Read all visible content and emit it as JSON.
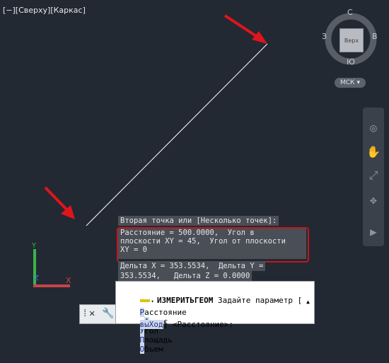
{
  "viewport": {
    "label": "[−][Сверху][Каркас]"
  },
  "viewcube": {
    "north": "С",
    "south": "Ю",
    "east": "В",
    "west": "З",
    "face": "Верх",
    "ucs_label": "МСК",
    "ucs_arrow": "▾"
  },
  "navbar": {
    "icons": [
      "steering-wheel-icon",
      "pan-icon",
      "zoom-icon",
      "orbit-icon",
      "showmotion-icon"
    ]
  },
  "dynamic_input": {
    "prompt": "Вторая точка или [Несколько точек]:",
    "result_lines": [
      "Расстояние = 500.0000,  Угол в",
      "плоскости XY = 45,  Угол от плоскости",
      "XY = 0"
    ],
    "delta_lines": [
      "Дельта X = 353.5534,  Дельта Y =",
      "353.5534,   Дельта Z = 0.0000"
    ]
  },
  "command_line": {
    "command": "ИЗМЕРИТЬГЕОМ",
    "prompt": "Задайте параметр [",
    "options": [
      {
        "pre": "",
        "hot": "Р",
        "post": "асстояние"
      },
      {
        "pre": "р",
        "hot": "А",
        "post": "диус"
      },
      {
        "pre": "",
        "hot": "У",
        "post": "гол"
      },
      {
        "pre": "",
        "hot": "П",
        "post": "лощадь"
      },
      {
        "pre": "",
        "hot": "О",
        "post": "бъем"
      }
    ],
    "exit_option": "выХод",
    "tail": "] <Расстояние>:"
  },
  "mini_toolbar": {
    "close": "✕",
    "customize": "🔧",
    "grip": "⁞"
  },
  "colors": {
    "background": "#222933",
    "highlight_box": "#c4161c",
    "arrow": "#e1141b",
    "ucs_x": "#c8444a",
    "ucs_y": "#3bb34a",
    "ucs_z": "#3a7ad8"
  }
}
